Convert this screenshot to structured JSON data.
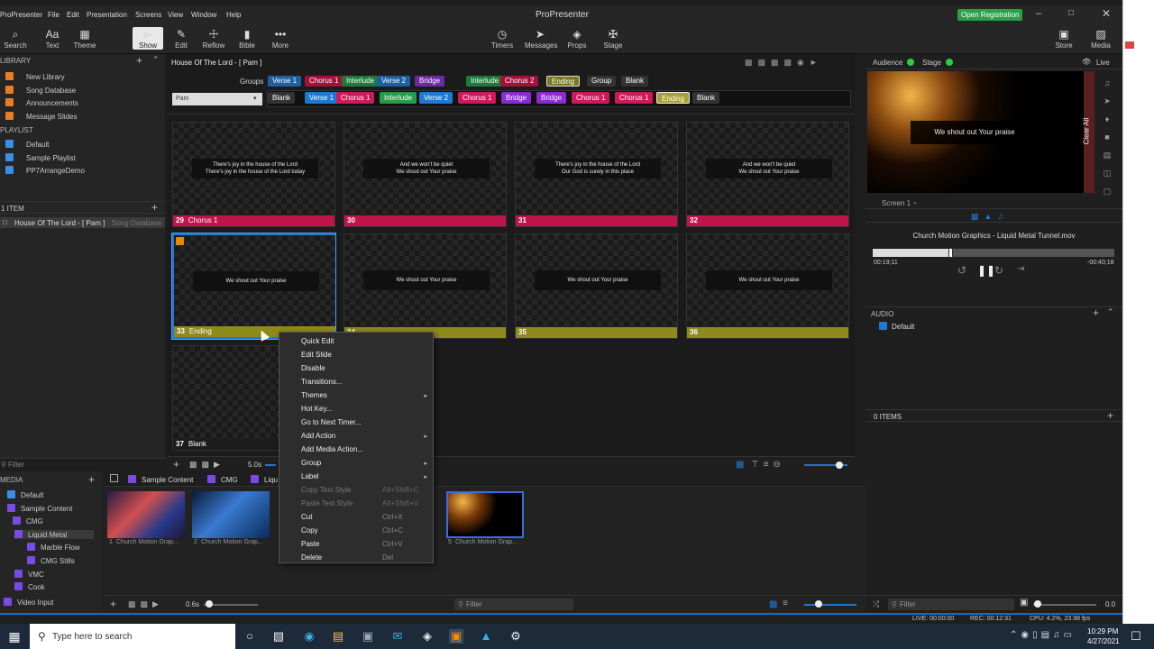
{
  "app": {
    "title": "ProPresenter",
    "menu": [
      "ProPresenter",
      "File",
      "Edit",
      "Presentation",
      "Screens",
      "View",
      "Window",
      "Help"
    ],
    "registration": "Open Registration"
  },
  "toolbar": {
    "left": [
      {
        "label": "Search",
        "icon": "search-icon"
      },
      {
        "label": "Text",
        "icon": "text-icon"
      },
      {
        "label": "Theme",
        "icon": "theme-icon"
      }
    ],
    "mode": [
      {
        "label": "Show",
        "icon": "play-icon"
      },
      {
        "label": "Edit",
        "icon": "pencil-icon"
      },
      {
        "label": "Reflow",
        "icon": "reflow-icon"
      },
      {
        "label": "Bible",
        "icon": "bible-icon"
      },
      {
        "label": "More",
        "icon": "more-icon"
      }
    ],
    "center": [
      {
        "label": "Timers",
        "icon": "timer-icon"
      },
      {
        "label": "Messages",
        "icon": "messages-icon"
      },
      {
        "label": "Props",
        "icon": "props-icon"
      },
      {
        "label": "Stage",
        "icon": "stage-icon"
      }
    ],
    "right": [
      {
        "label": "Store",
        "icon": "store-icon"
      },
      {
        "label": "Media",
        "icon": "media-icon"
      }
    ]
  },
  "library": {
    "header": "LIBRARY",
    "items": [
      "New Library",
      "Song Database",
      "Announcements",
      "Message Slides"
    ],
    "playlist_header": "PLAYLIST",
    "playlists": [
      "Default",
      "Sample Playlist",
      "PP7ArrangeDemo"
    ],
    "count_header": "1 ITEM",
    "selected_item": "House Of The Lord - [ Pam ]",
    "selected_source": "Song Database",
    "filter_placeholder": "Filter"
  },
  "editor": {
    "doc_title": "House Of The Lord - [ Pam ]",
    "groups_label": "Groups",
    "groups": [
      {
        "label": "Verse 1",
        "color": "#1f5fa0"
      },
      {
        "label": "Chorus 1",
        "color": "#a0123a"
      },
      {
        "label": "Interlude",
        "color": "#1e7a3a"
      },
      {
        "label": "Verse 2",
        "color": "#1f5fa0"
      },
      {
        "label": "Bridge",
        "color": "#6a2aa0"
      },
      {
        "label": "Interlude",
        "color": "#1e7a3a"
      },
      {
        "label": "Chorus 2",
        "color": "#a0123a"
      },
      {
        "label": "Ending",
        "color": "#7a7a20"
      },
      {
        "label": "Group",
        "color": "#333333"
      },
      {
        "label": "Blank",
        "color": "#333333"
      }
    ],
    "arrangement_name": "Pam",
    "arrangement": [
      {
        "label": "Blank",
        "color": "#333333"
      },
      {
        "label": "Verse 1",
        "color": "#1f78d1"
      },
      {
        "label": "Chorus 1",
        "color": "#cc1a5a"
      },
      {
        "label": "Interlude",
        "color": "#2a9a4a"
      },
      {
        "label": "Verse 2",
        "color": "#1f78d1"
      },
      {
        "label": "Chorus 1",
        "color": "#cc1a5a"
      },
      {
        "label": "Bridge",
        "color": "#8a2ad0"
      },
      {
        "label": "Bridge",
        "color": "#8a2ad0"
      },
      {
        "label": "Chorus 1",
        "color": "#cc1a5a"
      },
      {
        "label": "Chorus 1",
        "color": "#cc1a5a"
      },
      {
        "label": "Ending",
        "color": "#a8a030"
      },
      {
        "label": "Blank",
        "color": "#333333"
      }
    ],
    "slides": [
      {
        "num": "29",
        "group": "Chorus 1",
        "text": "There's joy in the house of the Lord\nThere's joy in the house of the Lord today",
        "color": "#c0154a"
      },
      {
        "num": "30",
        "group": "",
        "text": "And we won't be quiet\nWe shout out Your praise",
        "color": "#c0154a"
      },
      {
        "num": "31",
        "group": "",
        "text": "There's joy in the house of the Lord\nOur God is surely in this place",
        "color": "#c0154a"
      },
      {
        "num": "32",
        "group": "",
        "text": "And we won't be quiet\nWe shout out Your praise",
        "color": "#c0154a"
      },
      {
        "num": "33",
        "group": "Ending",
        "text": "We shout out Your praise",
        "color": "#8f8a1c"
      },
      {
        "num": "34",
        "group": "",
        "text": "We shout out Your praise",
        "color": "#8f8a1c"
      },
      {
        "num": "35",
        "group": "",
        "text": "We shout out Your praise",
        "color": "#8f8a1c"
      },
      {
        "num": "36",
        "group": "",
        "text": "We shout out Your praise",
        "color": "#8f8a1c"
      },
      {
        "num": "37",
        "group": "Blank",
        "text": "",
        "color": "#1c1c1c"
      }
    ],
    "transition_time": "5.0s"
  },
  "context_menu": [
    {
      "label": "Quick Edit"
    },
    {
      "label": "Edit Slide"
    },
    {
      "label": "Disable"
    },
    {
      "label": "Transitions..."
    },
    {
      "label": "Themes",
      "submenu": true
    },
    {
      "label": "Hot Key..."
    },
    {
      "label": "Go to Next Timer..."
    },
    {
      "label": "Add Action",
      "submenu": true
    },
    {
      "label": "Add Media Action..."
    },
    {
      "label": "Group",
      "submenu": true
    },
    {
      "label": "Label",
      "submenu": true
    },
    {
      "label": "Copy Text Style",
      "shortcut": "Alt+Shift+C",
      "disabled": true
    },
    {
      "label": "Paste Text Style",
      "shortcut": "Alt+Shift+V",
      "disabled": true
    },
    {
      "label": "Cut",
      "shortcut": "Ctrl+X"
    },
    {
      "label": "Copy",
      "shortcut": "Ctrl+C"
    },
    {
      "label": "Paste",
      "shortcut": "Ctrl+V"
    },
    {
      "label": "Delete",
      "shortcut": "Del"
    }
  ],
  "media": {
    "header": "MEDIA",
    "tree": [
      "Default",
      "Sample Content",
      "CMG",
      "Liquid Metal",
      "Marble Flow",
      "CMG Stills",
      "VMC",
      "Cook",
      "Video Input"
    ],
    "breadcrumb": [
      "Sample Content",
      "CMG",
      "Liqu"
    ],
    "thumbs": [
      "Church Motion Grap...",
      "Church Motion Grap...",
      "Church Motion Grap..."
    ],
    "thumb_nums": [
      "1",
      "2",
      "5"
    ],
    "zoom": "0.6s",
    "filter_placeholder": "Filter"
  },
  "right": {
    "audience": "Audience",
    "stage": "Stage",
    "live": "Live",
    "preview_text": "We shout out Your praise",
    "clear_all": "Clear All",
    "screen": "Screen 1",
    "video_title": "Church Motion Graphics - Liquid Metal Tunnel.mov",
    "elapsed": "00:19;11",
    "remaining": "-00:40;18",
    "playback_progress": 0.32,
    "audio_header": "AUDIO",
    "audio_item": "Default",
    "items_count": "0 ITEMS",
    "filter_placeholder": "Filter",
    "volume_value": "0.0"
  },
  "status": {
    "live": "LIVE: 00:00:00",
    "rec": "REC: 00:12:31",
    "cpu": "CPU: 4.2%, 23.98 fps"
  },
  "taskbar": {
    "search_placeholder": "Type here to search",
    "time": "10:29 PM",
    "date": "4/27/2021"
  }
}
